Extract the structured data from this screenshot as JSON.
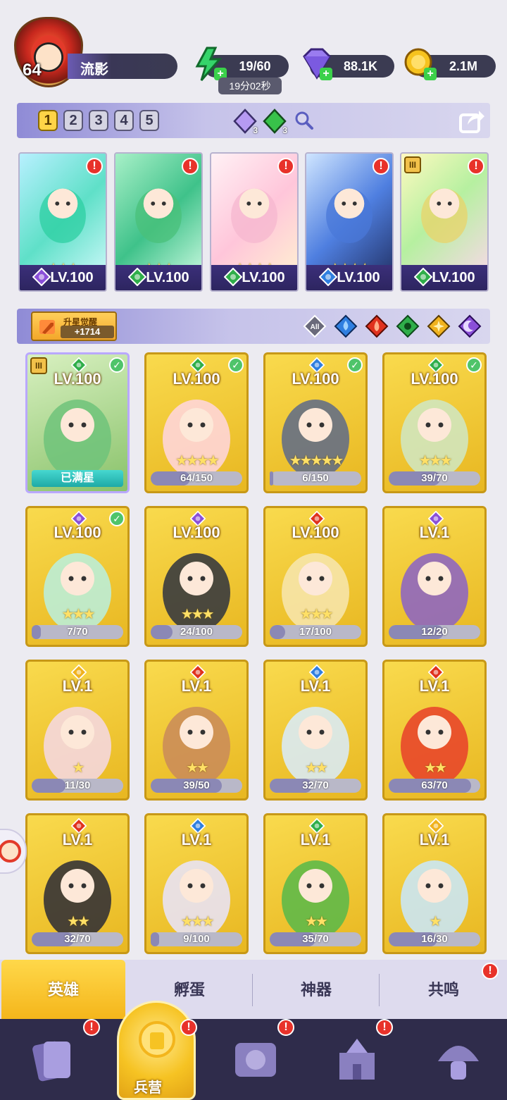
{
  "player": {
    "level": "64",
    "name": "流影"
  },
  "resources": {
    "energy": "19/60",
    "energy_timer": "19分02秒",
    "gems": "88.1K",
    "gold": "2.1M"
  },
  "team_tabs": [
    "1",
    "2",
    "3",
    "4",
    "5"
  ],
  "team_active": "1",
  "team_gems": {
    "purple_count": "3",
    "green_count": "3"
  },
  "lineup": [
    {
      "level": "LV.100",
      "stars": "★★★",
      "element": "purple",
      "color": "#2ecfa2",
      "alert": "!"
    },
    {
      "level": "LV.100",
      "stars": "★★★",
      "element": "green",
      "color": "#49c07a",
      "alert": "!"
    },
    {
      "level": "LV.100",
      "stars": "★★★★",
      "element": "green",
      "color": "#f5b7cf",
      "alert": "!"
    },
    {
      "level": "LV.100",
      "stars": "★★★★",
      "element": "blue",
      "color": "#4a78d8",
      "alert": "!"
    },
    {
      "level": "LV.100",
      "stars": "",
      "element": "green",
      "color": "#e9d36a",
      "alert": "!",
      "rank": "III"
    }
  ],
  "filter": {
    "awaken_label": "升星觉醒",
    "awaken_count": "+1714",
    "all_label": "All",
    "elements": [
      "water",
      "fire",
      "nature",
      "light",
      "dark"
    ]
  },
  "heroes": [
    {
      "level": "LV.100",
      "stars": "",
      "element": "green",
      "check": true,
      "maxed": "已满星",
      "rank": "III",
      "selected": true
    },
    {
      "level": "LV.100",
      "stars": "★★★★",
      "element": "green",
      "check": true,
      "frag": "64/150",
      "progress": 0.43
    },
    {
      "level": "LV.100",
      "stars": "★★★★★",
      "element": "blue",
      "check": true,
      "frag": "6/150",
      "progress": 0.04
    },
    {
      "level": "LV.100",
      "stars": "★★★",
      "element": "green",
      "check": true,
      "frag": "39/70",
      "progress": 0.56
    },
    {
      "level": "LV.100",
      "stars": "★★★",
      "element": "purple",
      "check": true,
      "frag": "7/70",
      "progress": 0.1
    },
    {
      "level": "LV.100",
      "stars": "★★★",
      "element": "purple",
      "check": false,
      "frag": "24/100",
      "progress": 0.24
    },
    {
      "level": "LV.100",
      "stars": "★★★",
      "element": "red",
      "check": false,
      "frag": "17/100",
      "progress": 0.17
    },
    {
      "level": "LV.1",
      "stars": "",
      "element": "purple",
      "check": false,
      "frag": "12/20",
      "progress": 0.6
    },
    {
      "level": "LV.1",
      "stars": "★",
      "element": "yellow",
      "check": false,
      "frag": "11/30",
      "progress": 0.37
    },
    {
      "level": "LV.1",
      "stars": "★★",
      "element": "red",
      "check": false,
      "frag": "39/50",
      "progress": 0.78
    },
    {
      "level": "LV.1",
      "stars": "★★",
      "element": "blue",
      "check": false,
      "frag": "32/70",
      "progress": 0.46
    },
    {
      "level": "LV.1",
      "stars": "★★",
      "element": "red",
      "check": false,
      "frag": "63/70",
      "progress": 0.9
    },
    {
      "level": "LV.1",
      "stars": "★★",
      "element": "red",
      "check": false,
      "frag": "32/70",
      "progress": 0.46
    },
    {
      "level": "LV.1",
      "stars": "★★★",
      "element": "blue",
      "check": false,
      "frag": "9/100",
      "progress": 0.09
    },
    {
      "level": "LV.1",
      "stars": "★★",
      "element": "green",
      "check": false,
      "frag": "35/70",
      "progress": 0.5
    },
    {
      "level": "LV.1",
      "stars": "★",
      "element": "yellow",
      "check": false,
      "frag": "16/30",
      "progress": 0.53
    }
  ],
  "subtabs": [
    "英雄",
    "孵蛋",
    "神器",
    "共鸣"
  ],
  "nav": {
    "active_label": "兵营"
  },
  "colors": {
    "purple": "#8a4fd8",
    "green": "#2fae4a",
    "blue": "#2f7fe0",
    "red": "#e0321e",
    "yellow": "#f0b21e",
    "alert": "#e8322a",
    "card_gold": "#f3c83a",
    "panel_purple": "#8f8bd6"
  }
}
